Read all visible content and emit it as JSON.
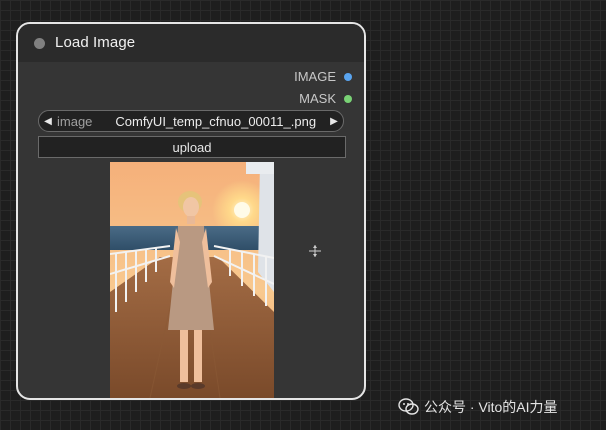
{
  "node": {
    "title": "Load Image",
    "outputs": [
      {
        "label": "IMAGE",
        "color": "#5aa5f0"
      },
      {
        "label": "MASK",
        "color": "#79d275"
      }
    ],
    "widget": {
      "label": "image",
      "value": "ComfyUI_temp_cfnuo_00011_.png"
    },
    "upload_label": "upload"
  },
  "watermark": {
    "text": "公众号 · Vito的AI力量"
  },
  "icons": {
    "collapse": "collapse-dot-icon",
    "prev": "arrow-left-icon",
    "next": "arrow-right-icon",
    "cursor": "move-cursor-icon",
    "watermark_logo": "wechat-icon"
  }
}
